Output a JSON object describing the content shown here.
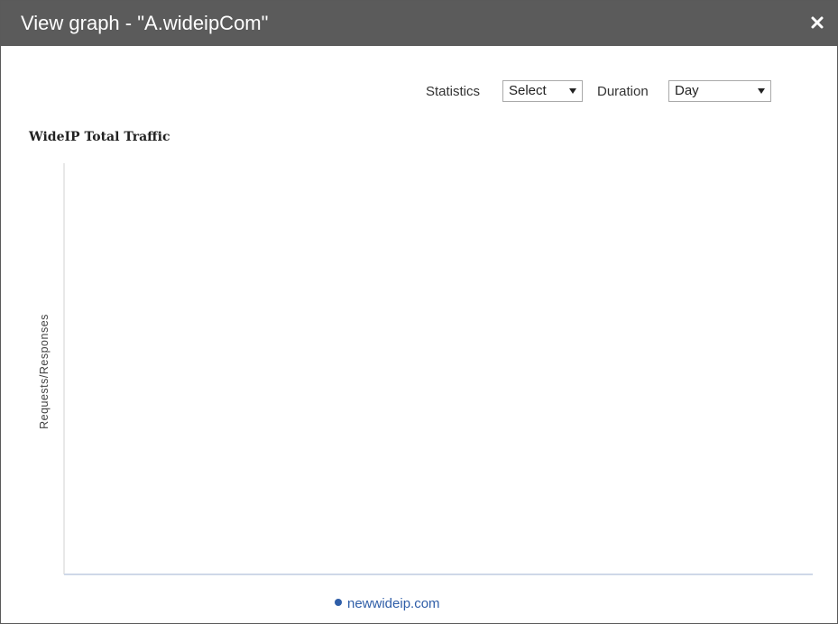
{
  "dialog": {
    "title": "View graph - \"A.wideipCom\"",
    "close_icon": "close-icon"
  },
  "toolbar": {
    "statistics_label": "Statistics",
    "statistics_value": "Select",
    "duration_label": "Duration",
    "duration_value": "Day"
  },
  "chart_data": {
    "type": "line",
    "title": "WideIP Total Traffic",
    "ylabel": "Requests/Responses",
    "xlabel": "",
    "series": [
      {
        "name": "newwideip.com",
        "values": []
      }
    ],
    "legend_position": "bottom-center",
    "grid": false
  },
  "colors": {
    "titlebar": "#5b5b5b",
    "series_1": "#2f5ea8",
    "x_axis": "#cfd8e8",
    "y_axis": "#d0d0d0"
  }
}
